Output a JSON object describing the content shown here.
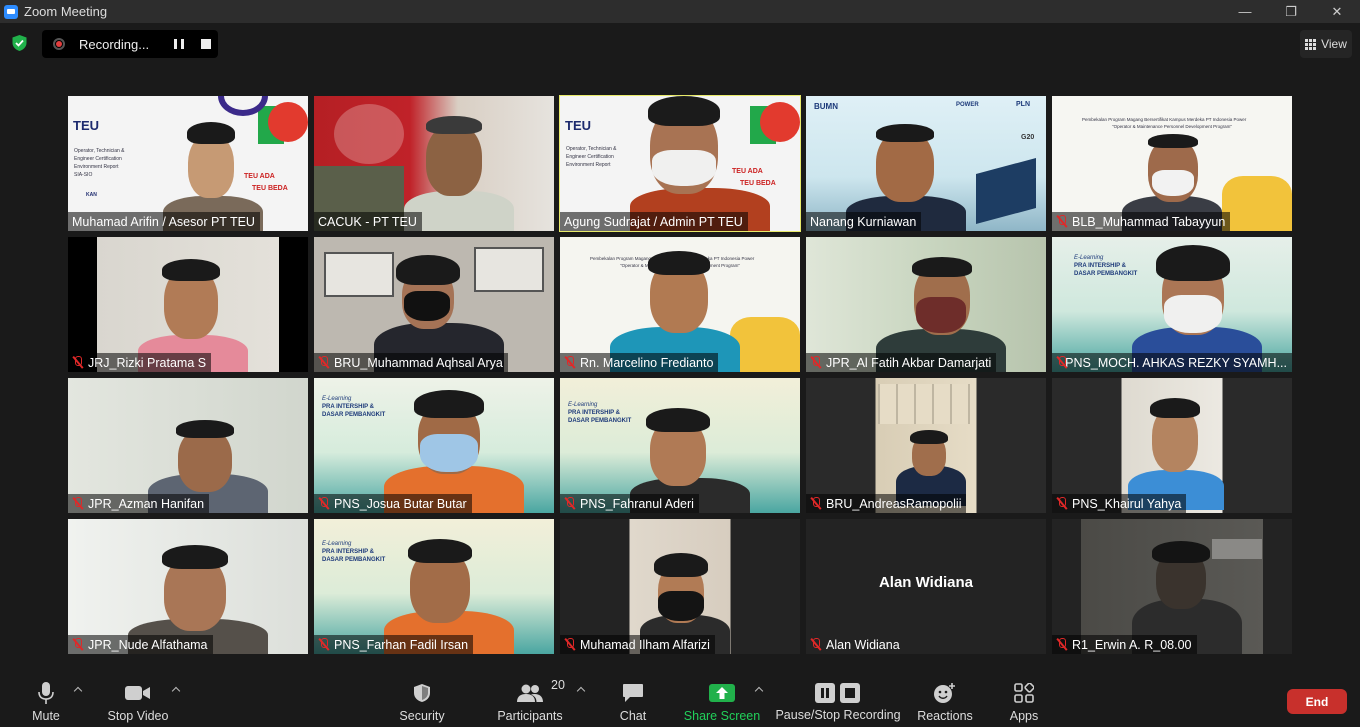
{
  "window": {
    "title": "Zoom Meeting"
  },
  "recording": {
    "label": "Recording..."
  },
  "view": {
    "label": "View"
  },
  "participants": [
    {
      "name": "Muhamad Arifin / Asesor PT TEU",
      "muted": false,
      "active": false
    },
    {
      "name": "CACUK - PT TEU",
      "muted": false,
      "active": false
    },
    {
      "name": "Agung Sudrajat / Admin PT TEU",
      "muted": false,
      "active": true
    },
    {
      "name": "Nanang Kurniawan",
      "muted": false,
      "active": false
    },
    {
      "name": "BLB_Muhammad Tabayyun",
      "muted": true,
      "active": false
    },
    {
      "name": "JRJ_Rizki Pratama S",
      "muted": true,
      "active": false
    },
    {
      "name": "BRU_Muhammad Aqhsal Arya",
      "muted": true,
      "active": false
    },
    {
      "name": "Rn. Marcelino Fredianto",
      "muted": true,
      "active": false
    },
    {
      "name": "JPR_Al Fatih Akbar Damarjati",
      "muted": true,
      "active": false
    },
    {
      "name": "PNS_MOCH. AHKAS REZKY SYAMH...",
      "muted": true,
      "active": false
    },
    {
      "name": "JPR_Azman Hanifan",
      "muted": true,
      "active": false
    },
    {
      "name": "PNS_Josua Butar Butar",
      "muted": true,
      "active": false
    },
    {
      "name": "PNS_Fahranul Aderi",
      "muted": true,
      "active": false
    },
    {
      "name": "BRU_AndreasRamopolii",
      "muted": true,
      "active": false
    },
    {
      "name": "PNS_Khairul Yahya",
      "muted": true,
      "active": false
    },
    {
      "name": "JPR_Nude Alfathama",
      "muted": true,
      "active": false
    },
    {
      "name": "PNS_Farhan Fadil Irsan",
      "muted": true,
      "active": false
    },
    {
      "name": "Muhamad Ilham Alfarizi",
      "muted": true,
      "active": false
    },
    {
      "name": "Alan Widiana",
      "muted": true,
      "active": false,
      "video_off": true
    },
    {
      "name": "R1_Erwin A. R_08.00",
      "muted": true,
      "active": false
    }
  ],
  "slides": {
    "teu_logo": "TEU",
    "teu_lines": [
      "Operator, Technician &",
      "Engineer Certification",
      "Environment Report",
      "SIA-SIO"
    ],
    "teu_ada": "TEU ADA",
    "teu_beda": "TEU BEDA",
    "program_title": "Pembekalan Program Magang Bersertifikat Kampus Merdeka PT Indonesia Power",
    "program_subtitle": "\"Operator & Maintenance Personnel Development Program\"",
    "elearning": "E-Learning",
    "pra_intership": "PRA INTERSHIP &",
    "dasar": "DASAR PEMBANGKIT",
    "bumn": "BUMN",
    "pln": "PLN",
    "g20": "G20",
    "power": "POWER",
    "kan": "KAN"
  },
  "toolbar": {
    "mute": "Mute",
    "stop_video": "Stop Video",
    "security": "Security",
    "participants": "Participants",
    "participant_count": "20",
    "chat": "Chat",
    "share_screen": "Share Screen",
    "pause_stop": "Pause/Stop Recording",
    "reactions": "Reactions",
    "apps": "Apps",
    "end": "End"
  },
  "colors": {
    "accent_green": "#21b14b",
    "end_red": "#c8302c",
    "active_speaker": "#e8ea6a",
    "muted_red": "#e02828"
  }
}
